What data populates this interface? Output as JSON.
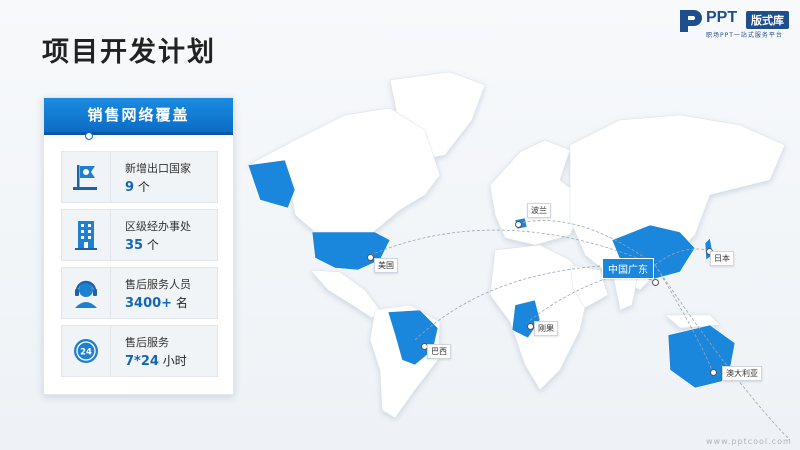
{
  "header": {
    "title": "项目开发计划"
  },
  "logo": {
    "brand": "PPT",
    "badge": "版式库",
    "tagline": "职场PPT一站式服务平台"
  },
  "panel": {
    "title": "销售网络覆盖",
    "items": [
      {
        "label": "新增出口国家",
        "value": "9",
        "unit": "个",
        "icon": "flag-icon"
      },
      {
        "label": "区级经办事处",
        "value": "35",
        "unit": "个",
        "icon": "building-icon"
      },
      {
        "label": "售后服务人员",
        "value": "3400+",
        "unit": "名",
        "icon": "headset-icon"
      },
      {
        "label": "售后服务",
        "value": "7*24",
        "unit": "小时",
        "icon": "24h-icon"
      }
    ]
  },
  "map": {
    "hub": "中国广东",
    "labels": {
      "usa": "美国",
      "poland": "波兰",
      "japan": "日本",
      "brazil": "巴西",
      "congo": "刚果",
      "australia": "澳大利亚"
    }
  },
  "footer": {
    "url": "www.pptcool.com"
  },
  "colors": {
    "accent": "#1a86dc",
    "dark_accent": "#0b6cc6",
    "brand": "#1f4e8c"
  }
}
